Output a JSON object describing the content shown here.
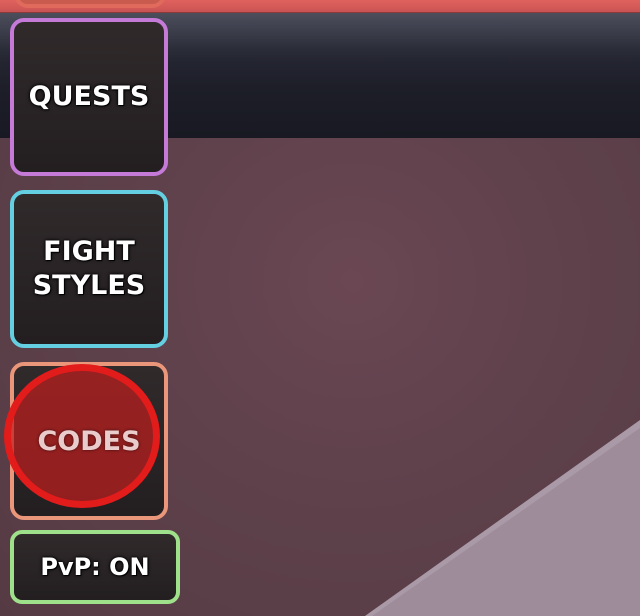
{
  "colors": {
    "quests_border": "#c57ad8",
    "fight_styles_border": "#65cfe2",
    "codes_border": "#e9967a",
    "pvp_border": "#9fe08a",
    "highlight_circle": "#e21b1b",
    "top_button": "#e06a5c"
  },
  "menu": {
    "quests_label": "QUESTS",
    "fight_styles_label_line1": "FIGHT",
    "fight_styles_label_line2": "STYLES",
    "codes_label": "CODES",
    "pvp_label": "PvP: ON"
  }
}
